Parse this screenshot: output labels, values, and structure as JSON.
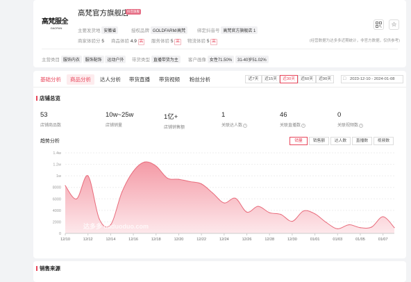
{
  "shop": {
    "logo_main": "高梵服全",
    "logo_sub": "GAOFAN",
    "name": "高梵官方旗舰店",
    "badge": "抖音旗舰",
    "ship_from_label": "主要发货地",
    "ship_from_value": "安徽省",
    "brand_label": "授权品牌",
    "brand_value": "GOLDFARM/高梵",
    "linked_label": "绑定抖音号",
    "linked_value": "高梵官方旗舰店",
    "linked_suffix": "1",
    "goods_exp_label": "商家体验分",
    "goods_exp_value": "5",
    "product_exp_label": "商品体验",
    "product_exp_value": "4.9",
    "product_exp_tag": "高",
    "service_label": "服务体验",
    "service_value": "5",
    "service_tag": "高",
    "logistics_label": "物流体验",
    "logistics_value": "5",
    "logistics_tag": "高",
    "note": "(经营数据为达多多近期统计，非官方数据，仅供参考)",
    "category_label": "主营类目",
    "categories": [
      "服饰内衣",
      "服饰配饰",
      "运动户外"
    ],
    "type_label": "带货类型",
    "type_value": "直播带货为主",
    "audience_label": "客户画像",
    "audience_gender": "女性71.50%",
    "audience_age": "31-40岁51.02%"
  },
  "tabs": {
    "items": [
      "基础分析",
      "商品分析",
      "达人分析",
      "带货直播",
      "带货视频",
      "粉丝分析"
    ],
    "active_index": 0,
    "selected_index": 1,
    "ranges": [
      "近7天",
      "近15天",
      "近30天",
      "近60天",
      "近90天"
    ],
    "active_range": 2,
    "date_range": "2023-12-10 - 2024-01-08"
  },
  "overview": {
    "title": "店铺总览",
    "kpis": [
      {
        "value": "53",
        "label": "店铺商品数",
        "help": false
      },
      {
        "value": "10w~25w",
        "label": "店铺销量",
        "help": false
      },
      {
        "value": "1亿+",
        "label": "店铺销售额",
        "help": false
      },
      {
        "value": "1",
        "label": "关联达人数",
        "help": true
      },
      {
        "value": "46",
        "label": "关联直播数",
        "help": true
      },
      {
        "value": "0",
        "label": "关联视频数",
        "help": true
      }
    ]
  },
  "trend": {
    "title": "趋势分析",
    "metrics": [
      "销量",
      "销售额",
      "达人数",
      "直播数",
      "视频数"
    ],
    "active_metric": 0
  },
  "chart_data": {
    "type": "area",
    "x": [
      "12/10",
      "12/11",
      "12/12",
      "12/13",
      "12/14",
      "12/15",
      "12/16",
      "12/17",
      "12/18",
      "12/19",
      "12/20",
      "12/21",
      "12/22",
      "12/23",
      "12/24",
      "12/25",
      "12/26",
      "12/27",
      "12/28",
      "12/29",
      "12/30",
      "12/31",
      "01/01",
      "01/02",
      "01/03",
      "01/04",
      "01/05",
      "01/06",
      "01/07",
      "01/08"
    ],
    "x_tick_labels": [
      "12/10",
      "12/12",
      "12/14",
      "12/16",
      "12/18",
      "12/20",
      "12/22",
      "12/24",
      "12/26",
      "12/28",
      "12/30",
      "01/01",
      "01/03",
      "01/05",
      "01/07"
    ],
    "series": [
      {
        "values": [
          8300,
          6000,
          10000,
          2500,
          1500,
          7200,
          10800,
          12400,
          11700,
          9600,
          9400,
          9000,
          8600,
          7000,
          5300,
          6100,
          3700,
          4700,
          3600,
          3300,
          2100,
          3900,
          3400,
          1900,
          800,
          1500,
          1000,
          1100,
          2900,
          1000
        ]
      }
    ],
    "yticks": [
      0,
      2000,
      4000,
      6000,
      8000,
      "1w",
      "1.2w",
      "1.4w"
    ],
    "ylim": [
      0,
      14000
    ],
    "grid": true,
    "colors": {
      "line": "#e86b7b",
      "fill_top": "#f49aa6",
      "fill_bottom": "#fde8eb"
    },
    "watermark": "达多多 daduoduo.com"
  },
  "bottom": {
    "title": "销售来源"
  }
}
